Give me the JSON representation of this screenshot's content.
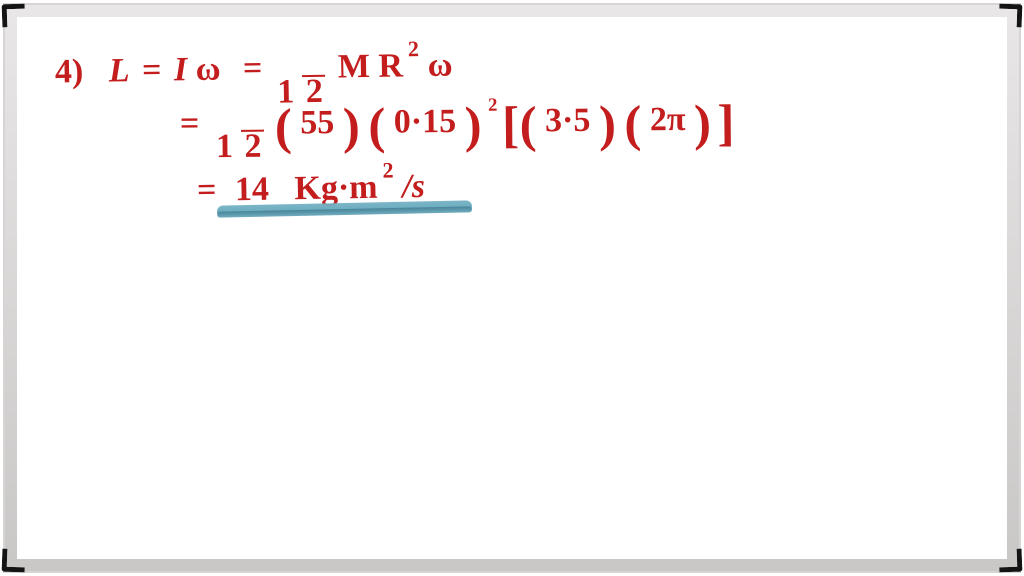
{
  "line1": {
    "problem_no": "4)",
    "L": "L",
    "eq1": "=",
    "I": "I",
    "omega1": "ω",
    "eq2": "=",
    "half_num": "1",
    "half_den": "2",
    "M": "M",
    "R": "R",
    "sq1": "2",
    "omega2": "ω"
  },
  "line2": {
    "eq": "=",
    "half_num": "1",
    "half_den": "2",
    "p_open1": "(",
    "v55": "55",
    "p_close1": ")",
    "p_open2": "(",
    "v015": "0·15",
    "p_close2": ")",
    "sq": "2",
    "br_open": "[",
    "p_open3": "(",
    "v35": "3·5",
    "p_close3": ")",
    "p_open4": "(",
    "v2pi": "2π",
    "p_close4": ")",
    "br_close": "]"
  },
  "line3": {
    "eq": "=",
    "val": "14",
    "unit_kgm": "Kg·m",
    "unit_sq": "2",
    "unit_slash_s": "/s"
  }
}
